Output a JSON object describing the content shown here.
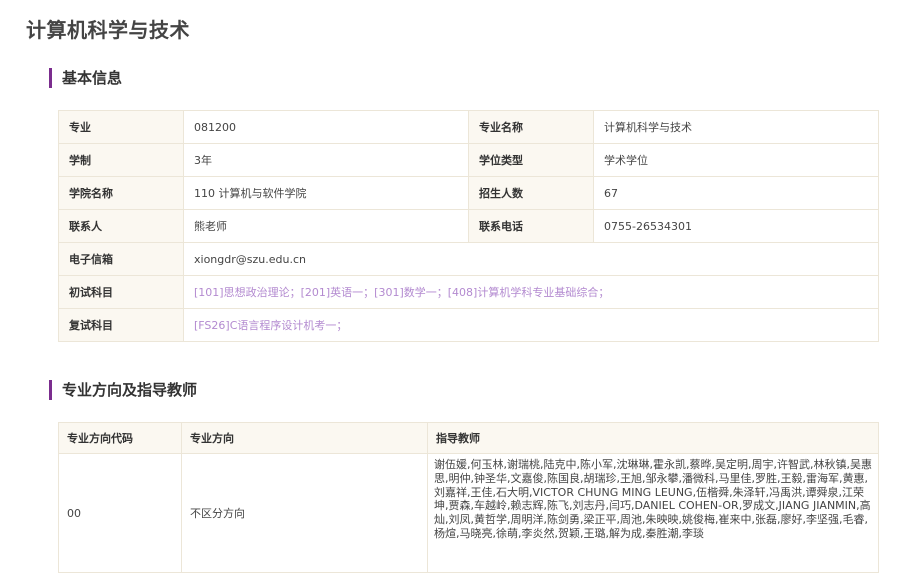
{
  "page": {
    "title": "计算机科学与技术"
  },
  "basic_info": {
    "section_title": "基本信息",
    "rows": [
      {
        "k1": "专业",
        "v1": "081200",
        "k2": "专业名称",
        "v2": "计算机科学与技术"
      },
      {
        "k1": "学制",
        "v1": "3年",
        "k2": "学位类型",
        "v2": "学术学位"
      },
      {
        "k1": "学院名称",
        "v1": "110 计算机与软件学院",
        "k2": "招生人数",
        "v2": "67"
      },
      {
        "k1": "联系人",
        "v1": "熊老师",
        "k2": "联系电话",
        "v2": "0755-26534301"
      }
    ],
    "email": {
      "label": "电子信箱",
      "value": "xiongdr@szu.edu.cn"
    },
    "initial_exam": {
      "label": "初试科目",
      "items": [
        "[101]思想政治理论；",
        "[201]英语一；",
        "[301]数学一；",
        "[408]计算机学科专业基础综合；"
      ]
    },
    "retest": {
      "label": "复试科目",
      "items": [
        "[FS26]C语言程序设计机考一；"
      ]
    }
  },
  "directions": {
    "section_title": "专业方向及指导教师",
    "headers": [
      "专业方向代码",
      "专业方向",
      "指导教师"
    ],
    "rows": [
      {
        "code": "00",
        "name": "不区分方向",
        "advisors": "谢伍媛,何玉林,谢瑞桃,陆克中,陈小军,沈琳琳,霍永凯,蔡晔,吴定明,周宇,许智武,林秋镇,吴惠思,明仲,钟圣华,文嘉俊,陈国良,胡瑞珍,王旭,邹永攀,潘微科,马里佳,罗胜,王毅,雷海军,黄惠,刘嘉祥,王佳,石大明,VICTOR CHUNG MING LEUNG,伍楷舜,朱泽轩,冯禹洪,谭舜泉,江荣坤,贾森,车越岭,赖志辉,陈飞,刘志丹,闫巧,DANIEL COHEN-OR,罗成文,JIANG JIANMIN,高灿,刘凤,黄哲学,周明洋,陈剑勇,梁正平,周池,朱映映,姚俊梅,崔来中,张磊,廖好,李坚强,毛睿,杨煊,马晓亮,徐萌,李炎然,贺颖,王璐,解为成,秦胜潮,李琰"
      }
    ]
  }
}
